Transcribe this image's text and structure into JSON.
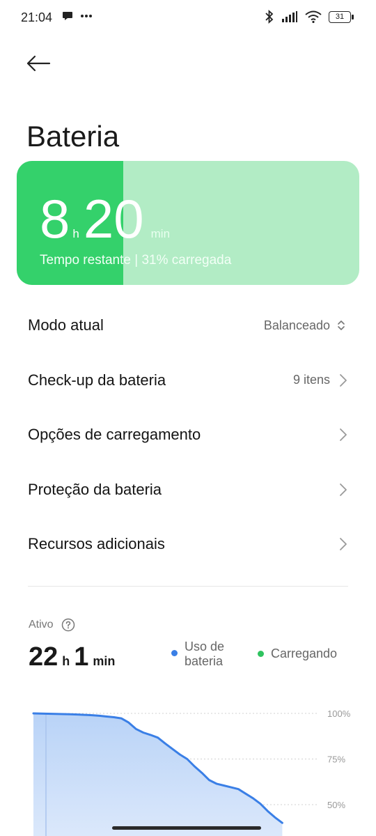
{
  "status_bar": {
    "time": "21:04",
    "battery_level": "31"
  },
  "header": {
    "title": "Bateria"
  },
  "battery_card": {
    "hours": "8",
    "hours_unit": "h",
    "minutes": "20",
    "minutes_unit": "min",
    "subtitle": "Tempo restante | 31% carregada",
    "charge_fraction": 0.31,
    "fill_color": "#34d16b",
    "track_color": "#b2ecc5"
  },
  "settings": {
    "items": [
      {
        "label": "Modo atual",
        "value": "Balanceado",
        "icon": "updown-icon"
      },
      {
        "label": "Check-up da bateria",
        "value": "9 itens",
        "icon": "chevron-right-icon"
      },
      {
        "label": "Opções de carregamento",
        "value": "",
        "icon": "chevron-right-icon"
      },
      {
        "label": "Proteção da bateria",
        "value": "",
        "icon": "chevron-right-icon"
      },
      {
        "label": "Recursos adicionais",
        "value": "",
        "icon": "chevron-right-icon"
      }
    ]
  },
  "usage": {
    "active_label": "Ativo",
    "active_hours": "22",
    "hours_unit": "h",
    "active_minutes": "1",
    "minutes_unit": "min",
    "legend": {
      "usage": "Uso de bateria",
      "charging": "Carregando",
      "usage_color": "#3a7fe6",
      "charging_color": "#2fc35f"
    }
  },
  "chart_data": {
    "type": "area",
    "ytick_labels": [
      "100%",
      "75%",
      "50%"
    ],
    "ylim": [
      40,
      100
    ],
    "x": [
      0,
      10,
      20,
      30,
      40,
      50,
      60,
      70,
      80,
      90,
      100,
      110,
      120,
      130,
      140,
      150,
      160,
      170,
      180,
      190,
      200,
      210,
      220,
      230,
      240,
      250,
      260,
      270,
      280,
      290,
      300,
      310,
      320,
      330,
      340,
      350,
      360,
      370,
      380,
      390
    ],
    "series": [
      {
        "values": [
          100,
          99.9,
          99.8,
          99.7,
          99.6,
          99.5,
          99.4,
          99.2,
          99,
          98.7,
          98.3,
          97.9,
          97.3,
          95,
          91.5,
          89.5,
          88.2,
          86.7,
          83.5,
          80.5,
          77.5,
          75,
          71,
          67.5,
          63.5,
          61.5,
          60.5,
          59.5,
          58.5,
          56,
          53.5,
          50.5,
          46.5,
          43,
          40
        ]
      }
    ],
    "grid": true
  }
}
